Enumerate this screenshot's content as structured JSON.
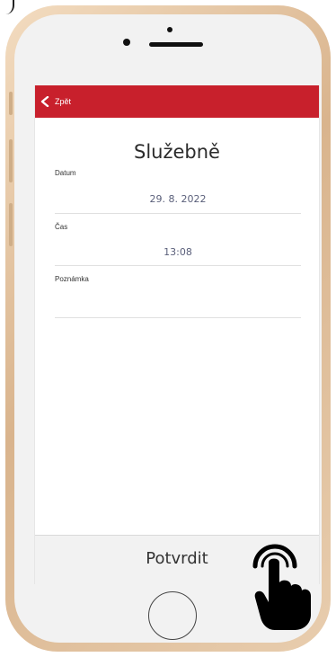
{
  "nav": {
    "back_label": "Zpět",
    "accent_color": "#c8202c"
  },
  "page": {
    "title": "Služebně"
  },
  "form": {
    "date": {
      "label": "Datum",
      "value": "29. 8. 2022"
    },
    "time": {
      "label": "Čas",
      "value": "13:08"
    },
    "note": {
      "label": "Poznámka",
      "value": ""
    }
  },
  "footer": {
    "confirm_label": "Potvrdit"
  },
  "icons": [
    "chevron-left-icon",
    "tap-hand-icon"
  ]
}
